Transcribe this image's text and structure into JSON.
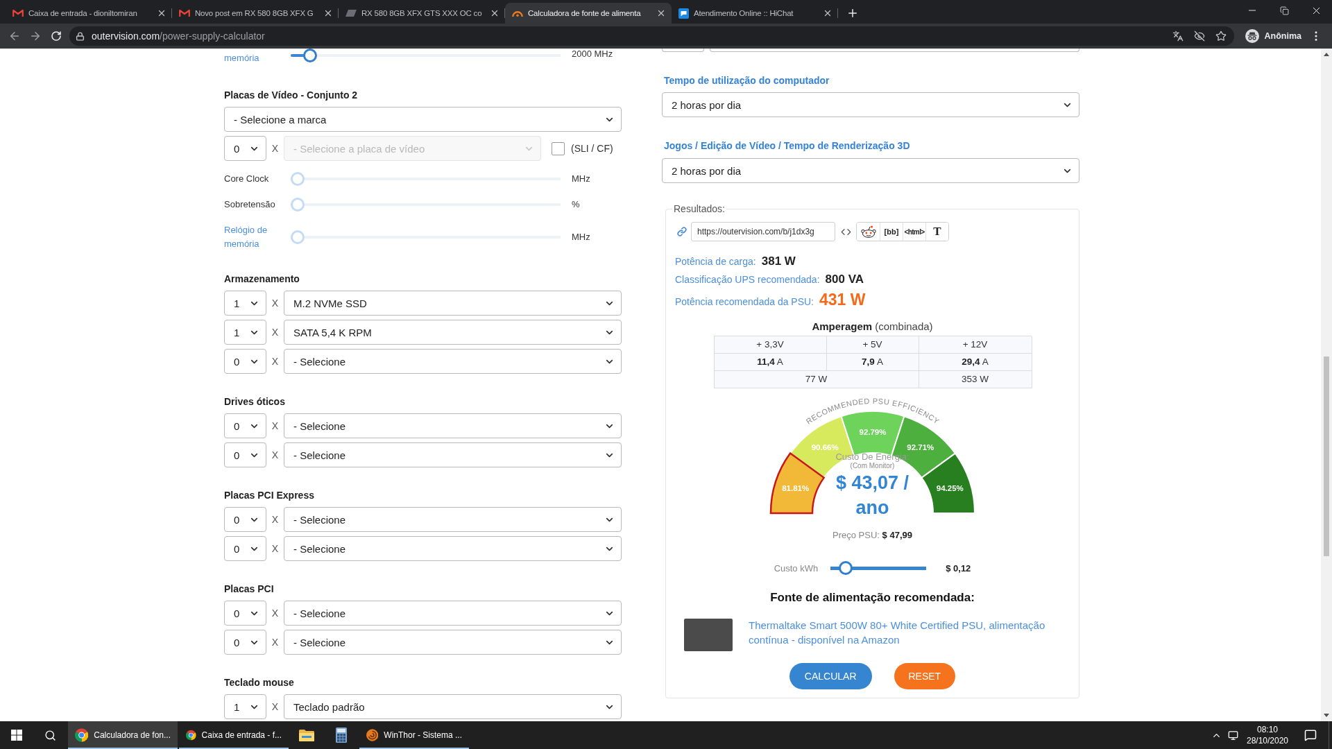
{
  "browser": {
    "tabs": [
      {
        "kind": "mail",
        "title": "Caixa de entrada - dioniltomiran",
        "selected": false
      },
      {
        "kind": "mail",
        "title": "Novo post em RX 580 8GB XFX G",
        "selected": false
      },
      {
        "kind": "forum",
        "title": "RX 580 8GB XFX GTS XXX OC co",
        "selected": false
      },
      {
        "kind": "arc",
        "title": "Calculadora de fonte de alimenta",
        "selected": true
      },
      {
        "kind": "chat",
        "title": "Atendimento Online :: HiChat",
        "selected": false
      }
    ],
    "address": {
      "host": "outervision.com",
      "path": "/power-supply-calculator"
    },
    "profile": "Anônima"
  },
  "form": {
    "memory_slider": {
      "kind": "link",
      "label": "memória",
      "level": 0.05,
      "reading": "2000 MHz",
      "disabled": false
    },
    "video_set": {
      "heading": "Placas de Vídeo - Conjunto 2",
      "brand": "- Selecione a marca",
      "quantity": "0",
      "multiplier": "X",
      "card": {
        "placeholder": "- Selecione a placa de vídeo",
        "disabled": true
      },
      "sli": {
        "label": "(SLI / CF)",
        "checked": false
      },
      "sliders": [
        {
          "kind": "plain",
          "label": "Core Clock",
          "level": 0,
          "reading": "MHz",
          "disabled": true
        },
        {
          "kind": "plain",
          "label": "Sobretensão",
          "level": 0,
          "reading": "%",
          "disabled": true
        },
        {
          "kind": "link",
          "label": "Relógio de memória",
          "level": 0,
          "reading": "MHz",
          "disabled": true
        }
      ]
    },
    "sections": [
      {
        "heading": "Armazenamento",
        "rows": [
          {
            "quantity": "1",
            "multiplier": "X",
            "device": "M.2 NVMe SSD"
          },
          {
            "quantity": "1",
            "multiplier": "X",
            "device": "SATA 5,4 K RPM"
          },
          {
            "quantity": "0",
            "multiplier": "X",
            "device": "- Selecione"
          }
        ]
      },
      {
        "heading": "Drives óticos",
        "rows": [
          {
            "quantity": "0",
            "multiplier": "X",
            "device": "- Selecione"
          },
          {
            "quantity": "0",
            "multiplier": "X",
            "device": "- Selecione"
          }
        ]
      },
      {
        "heading": "Placas PCI Express",
        "rows": [
          {
            "quantity": "0",
            "multiplier": "X",
            "device": "- Selecione"
          },
          {
            "quantity": "0",
            "multiplier": "X",
            "device": "- Selecione"
          }
        ]
      },
      {
        "heading": "Placas PCI",
        "rows": [
          {
            "quantity": "0",
            "multiplier": "X",
            "device": "- Selecione"
          },
          {
            "quantity": "0",
            "multiplier": "X",
            "device": "- Selecione"
          }
        ]
      },
      {
        "heading": "Teclado mouse",
        "rows": [
          {
            "quantity": "1",
            "multiplier": "X",
            "device": "Teclado padrão"
          }
        ]
      }
    ]
  },
  "usage": {
    "cut_fields": [
      {
        "kind": "quantity"
      },
      {
        "kind": "device"
      }
    ],
    "questions": [
      {
        "label": "Tempo de utilização do computador",
        "value": "2 horas por dia"
      },
      {
        "label": "Jogos / Edição de Vídeo / Tempo de Renderização 3D",
        "value": "2 horas por dia"
      }
    ]
  },
  "results": {
    "legend": "Resultados:",
    "share_url": "https://outervision.com/b/j1dx3g",
    "share_buttons": [
      {
        "kind": "alien"
      },
      {
        "kind": "bb",
        "label": "[bb]"
      },
      {
        "kind": "html",
        "label": "<html>"
      },
      {
        "kind": "serif",
        "label": "T"
      }
    ],
    "metrics": [
      {
        "kind": "normal",
        "label": "Potência de carga:",
        "value": "381 W"
      },
      {
        "kind": "normal",
        "label": "Classificação UPS recomendada:",
        "value": "800 VA"
      },
      {
        "kind": "highlight",
        "label": "Potência recomendada da PSU:",
        "value": "431 W"
      }
    ],
    "amperage": {
      "title": "**Amperagem** (combinada)",
      "rails": [
        "+ 3,3V",
        "+ 5V",
        "+ 12V"
      ],
      "currents": [
        "**11,4** A",
        "**7,9** A",
        "**29,4** A"
      ],
      "watts": [
        {
          "kind": "shared",
          "value": "77 W"
        },
        {
          "kind": "single",
          "value": "353 W"
        }
      ]
    },
    "gauge": {
      "title": "RECOMMENDED PSU EFFICIENCY",
      "segments": [
        {
          "label": "81.81%",
          "color": "#f2b938",
          "selected": true
        },
        {
          "label": "90.66%",
          "color": "#d7ea5e",
          "selected": false
        },
        {
          "label": "92.79%",
          "color": "#6dd35b",
          "selected": false
        },
        {
          "label": "92.71%",
          "color": "#4caf3e",
          "selected": false
        },
        {
          "label": "94.25%",
          "color": "#277f1f",
          "selected": false
        }
      ],
      "caption": "Custo De Energia:",
      "note": "(Com Monitor)",
      "cost": "$ 43,07 / ano"
    },
    "price": "Preço PSU: **$ 47,99**",
    "kwh": {
      "label": "Custo kWh",
      "level": 0.1,
      "reading": "$ 0,12"
    },
    "recommendation": {
      "heading": "Fonte de alimentação recomendada:",
      "product": "Thermaltake Smart 500W 80+ White Certified PSU, alimentação contínua - disponível na Amazon"
    },
    "buttons": [
      {
        "kind": "primary",
        "label": "CALCULAR"
      },
      {
        "kind": "reset",
        "label": "RESET"
      }
    ]
  },
  "taskbar": {
    "apps": [
      {
        "kind": "browser",
        "label": "Calculadora de fon...",
        "selected": true,
        "open": true
      },
      {
        "kind": "browser",
        "label": "Caixa de entrada - f...",
        "selected": false,
        "open": true
      },
      {
        "kind": "folder",
        "selected": false,
        "open": false
      },
      {
        "kind": "calculator",
        "selected": false,
        "open": false
      },
      {
        "kind": "swirl",
        "label": "WinThor - Sistema ...",
        "selected": false,
        "open": true
      }
    ],
    "time": "08:10",
    "date": "28/10/2020"
  }
}
